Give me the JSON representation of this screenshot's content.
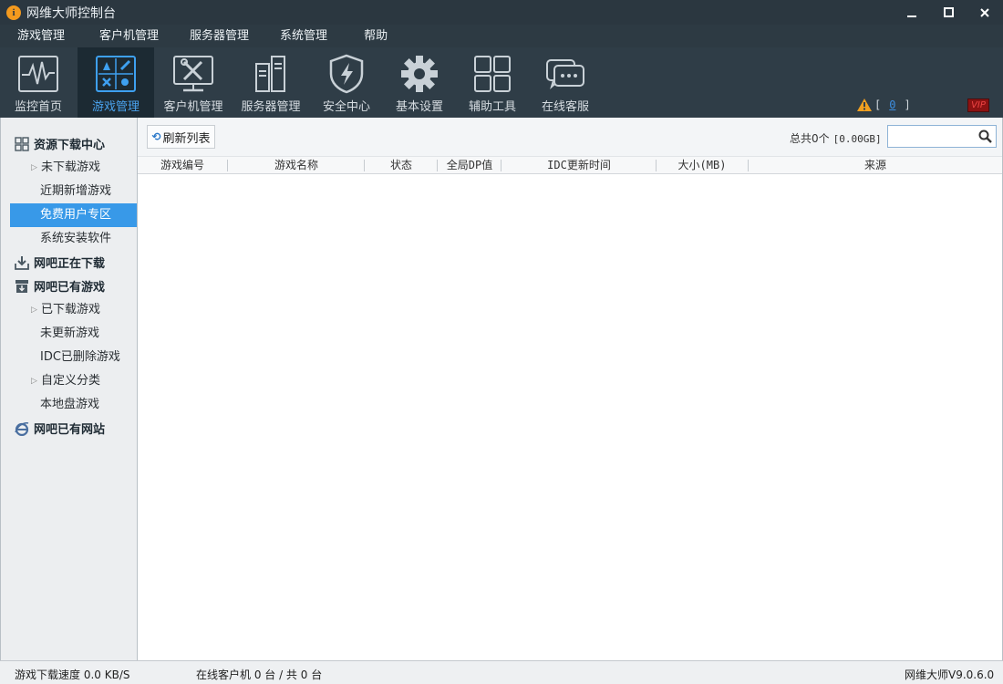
{
  "window": {
    "title": "网维大师控制台",
    "minimize": "−",
    "maximize": "☐",
    "close": "×"
  },
  "menu": [
    "游戏管理",
    "客户机管理",
    "服务器管理",
    "系统管理",
    "帮助"
  ],
  "toolbar": {
    "items": [
      {
        "label": "监控首页",
        "icon": "monitor-pulse-icon"
      },
      {
        "label": "游戏管理",
        "icon": "game-controls-icon"
      },
      {
        "label": "客户机管理",
        "icon": "tools-screen-icon"
      },
      {
        "label": "服务器管理",
        "icon": "server-icon"
      },
      {
        "label": "安全中心",
        "icon": "shield-bolt-icon"
      },
      {
        "label": "基本设置",
        "icon": "gear-icon"
      },
      {
        "label": "辅助工具",
        "icon": "grid-icon"
      },
      {
        "label": "在线客服",
        "icon": "chat-icon"
      }
    ],
    "active_index": 1,
    "warning_open": "[",
    "warning_count": "0",
    "warning_close": "]",
    "vip_label": "VIP"
  },
  "sidebar": {
    "groups": [
      {
        "label": "资源下载中心",
        "icon": "grid-squares-icon"
      },
      {
        "label": "网吧正在下载",
        "icon": "download-icon"
      },
      {
        "label": "网吧已有游戏",
        "icon": "archive-icon"
      },
      {
        "label": "网吧已有网站",
        "icon": "ie-browser-icon"
      }
    ],
    "items": [
      {
        "label": "未下载游戏",
        "expandable": true
      },
      {
        "label": "近期新增游戏",
        "expandable": false
      },
      {
        "label": "免费用户专区",
        "expandable": false,
        "selected": true
      },
      {
        "label": "系统安装软件",
        "expandable": false
      },
      {
        "label": "已下载游戏",
        "expandable": true
      },
      {
        "label": "未更新游戏",
        "expandable": false
      },
      {
        "label": "IDC已删除游戏",
        "expandable": false
      },
      {
        "label": "自定义分类",
        "expandable": true
      },
      {
        "label": "本地盘游戏",
        "expandable": false
      }
    ]
  },
  "main": {
    "refresh_label": "刷新列表",
    "total_label": "总共0个",
    "total_size": "[0.00GB]",
    "search_placeholder": "",
    "columns": [
      "游戏编号",
      "游戏名称",
      "状态",
      "全局DP值",
      "IDC更新时间",
      "大小(MB)",
      "来源"
    ],
    "rows": []
  },
  "status": {
    "download_speed": "游戏下载速度 0.0 KB/S",
    "online_clients": "在线客户机 0 台 / 共 0 台",
    "version": "网维大师V9.0.6.0"
  },
  "colors": {
    "accent": "#3899e8",
    "titlebar": "#2b3740",
    "toolbar": "#2f3d47"
  }
}
